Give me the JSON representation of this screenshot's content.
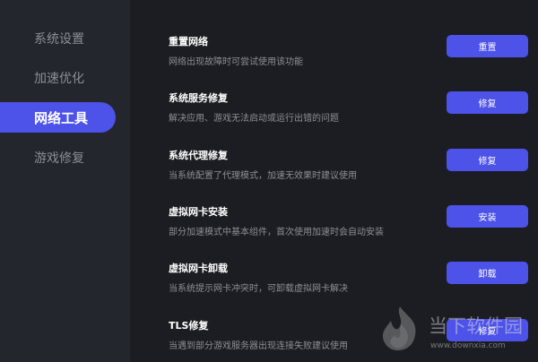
{
  "sidebar": {
    "items": [
      {
        "label": "系统设置"
      },
      {
        "label": "加速优化"
      },
      {
        "label": "网络工具"
      },
      {
        "label": "游戏修复"
      }
    ]
  },
  "tools": [
    {
      "title": "重置网络",
      "desc": "网络出现故障时可尝试使用该功能",
      "button": "重置"
    },
    {
      "title": "系统服务修复",
      "desc": "解决应用、游戏无法启动或运行出错的问题",
      "button": "修复"
    },
    {
      "title": "系统代理修复",
      "desc": "当系统配置了代理模式，加速无效果时建议使用",
      "button": "修复"
    },
    {
      "title": "虚拟网卡安装",
      "desc": "部分加速模式中基本组件，首次使用加速时会自动安装",
      "button": "安装"
    },
    {
      "title": "虚拟网卡卸载",
      "desc": "当系统提示网卡冲突时，可卸载虚拟网卡解决",
      "button": "卸载"
    },
    {
      "title": "TLS修复",
      "desc": "当遇到部分游戏服务器出现连接失败建议使用",
      "button": "修复"
    }
  ],
  "watermark": {
    "text": "当下软件园",
    "url": "www.downxia.com"
  },
  "colors": {
    "accent": "#4d52e8",
    "sidebar_bg": "#24262d",
    "main_bg": "#1c1d22"
  }
}
